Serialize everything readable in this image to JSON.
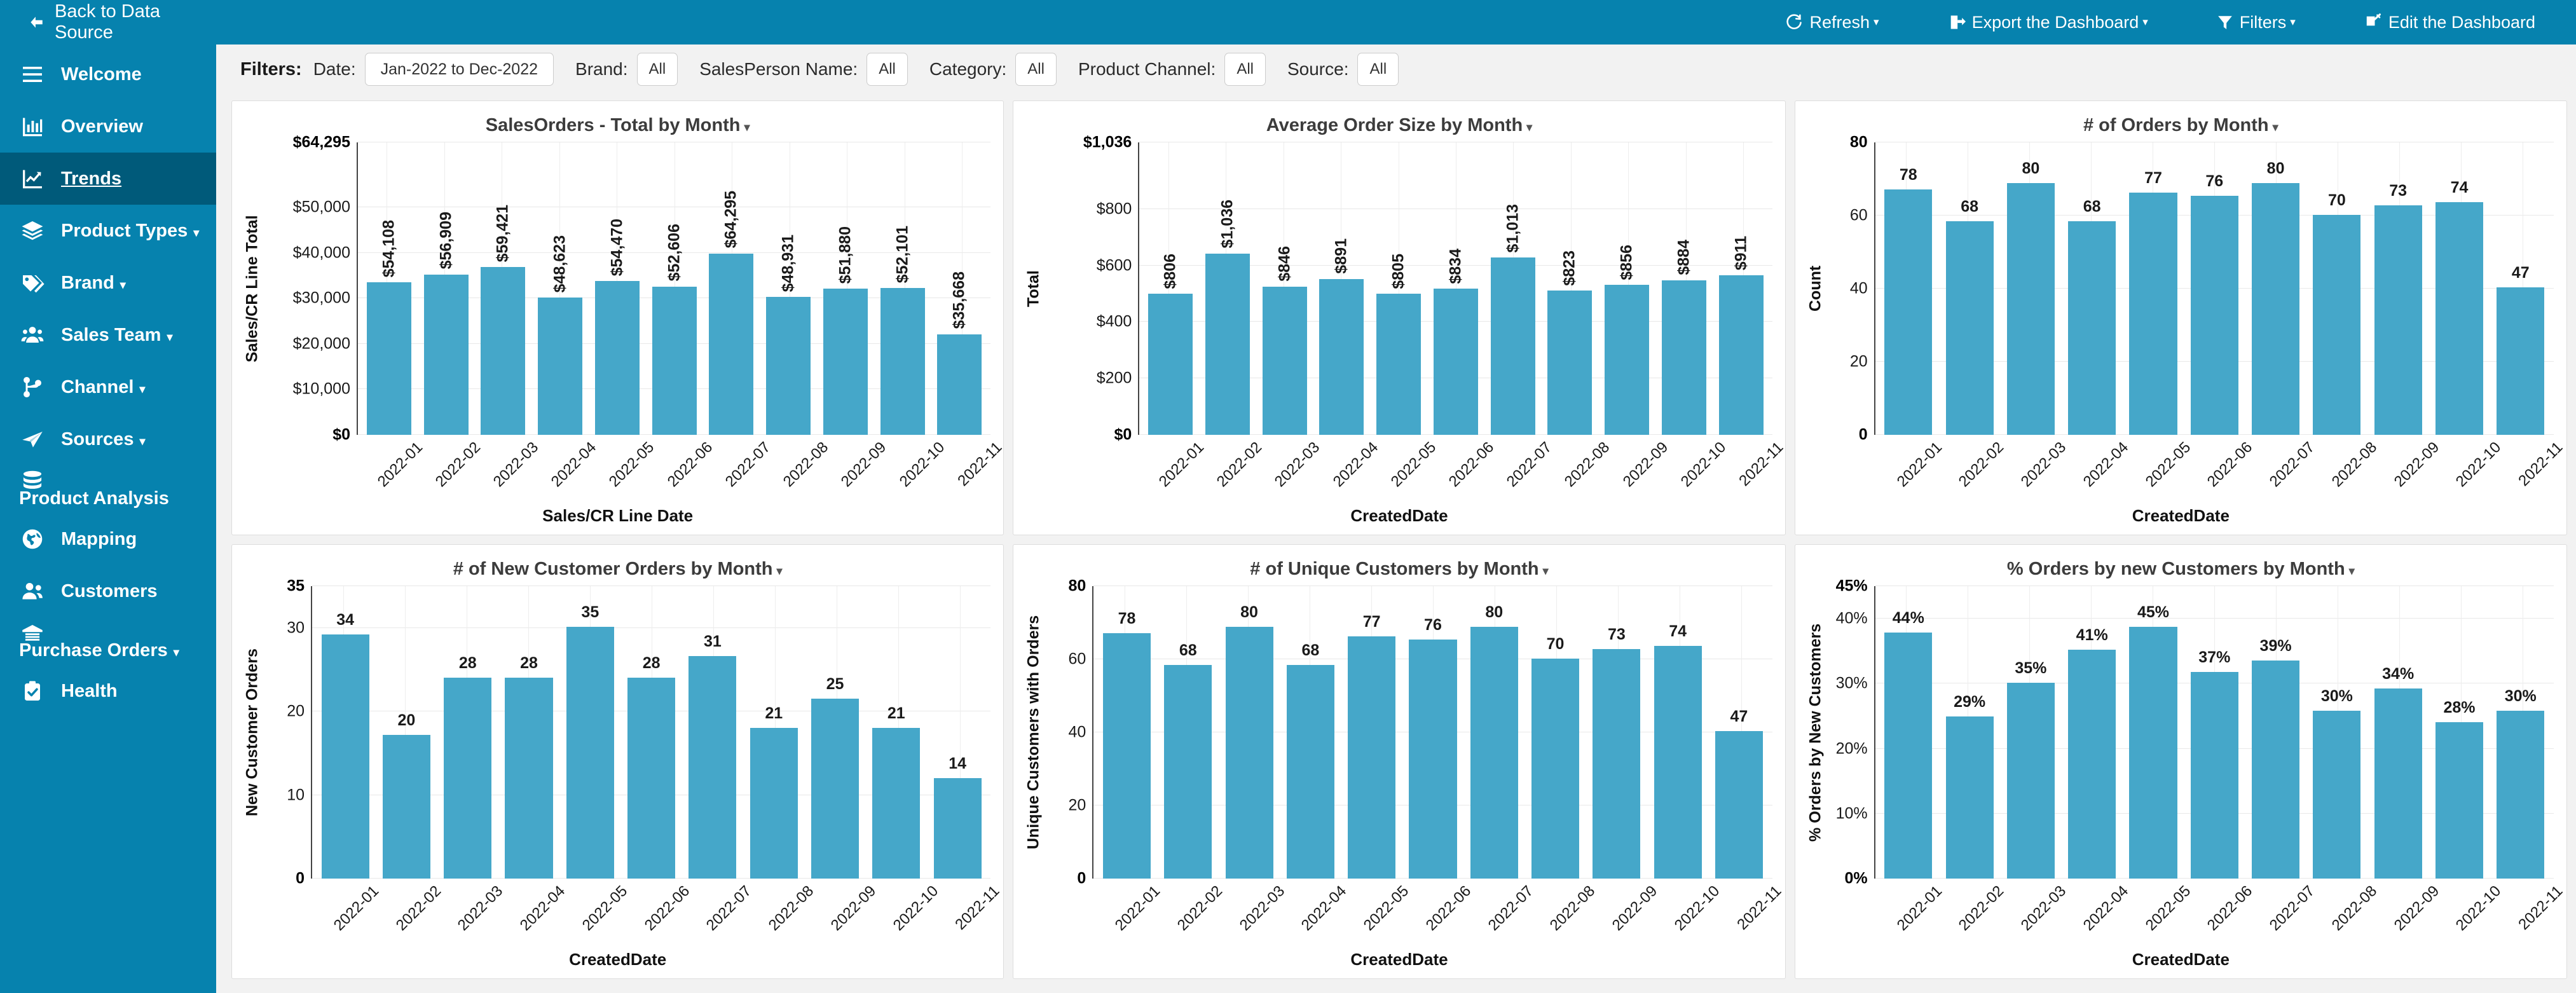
{
  "topbar": {
    "back_label": "Back to Data Source",
    "back_icon": "arrow-left-icon",
    "actions": [
      {
        "label": "Refresh",
        "icon": "refresh-icon",
        "caret": "▾"
      },
      {
        "label": "Export the Dashboard",
        "icon": "export-icon",
        "caret": "▾"
      },
      {
        "label": "Filters",
        "icon": "funnel-icon",
        "caret": "▾"
      },
      {
        "label": "Edit the Dashboard",
        "icon": "edit-icon",
        "caret": ""
      }
    ]
  },
  "sidebar": {
    "items": [
      {
        "label": "Welcome",
        "icon": "hamburger-icon",
        "caret": "",
        "active": false
      },
      {
        "label": "Overview",
        "icon": "bar-chart-icon",
        "caret": "",
        "active": false
      },
      {
        "label": "Trends",
        "icon": "line-chart-icon",
        "caret": "",
        "active": true
      },
      {
        "label": "Product Types",
        "icon": "layers-icon",
        "caret": "▾",
        "active": false
      },
      {
        "label": "Brand",
        "icon": "tag-icon",
        "caret": "▾",
        "active": false
      },
      {
        "label": "Sales Team",
        "icon": "users-group-icon",
        "caret": "▾",
        "active": false
      },
      {
        "label": "Channel",
        "icon": "sitemap-icon",
        "caret": "▾",
        "active": false
      },
      {
        "label": "Sources",
        "icon": "paper-plane-icon",
        "caret": "▾",
        "active": false
      },
      {
        "label": "Product Analysis",
        "icon": "database-icon",
        "caret": "",
        "active": false
      },
      {
        "label": "Mapping",
        "icon": "globe-icon",
        "caret": "",
        "active": false
      },
      {
        "label": "Customers",
        "icon": "users-icon",
        "caret": "",
        "active": false
      },
      {
        "label": "Purchase Orders",
        "icon": "warehouse-icon",
        "caret": "▾",
        "active": false
      },
      {
        "label": "Health",
        "icon": "clipboard-check-icon",
        "caret": "",
        "active": false
      }
    ]
  },
  "filters": {
    "title": "Filters:",
    "items": [
      {
        "name": "Date:",
        "value": "Jan-2022 to Dec-2022",
        "wide": true
      },
      {
        "name": "Brand:",
        "value": "All",
        "wide": false
      },
      {
        "name": "SalesPerson Name:",
        "value": "All",
        "wide": false
      },
      {
        "name": "Category:",
        "value": "All",
        "wide": false
      },
      {
        "name": "Product Channel:",
        "value": "All",
        "wide": false
      },
      {
        "name": "Source:",
        "value": "All",
        "wide": false
      }
    ]
  },
  "theme": {
    "brand_blue": "#0682ae",
    "active_blue": "#005a7a",
    "bar_blue": "#45a7c9",
    "page_bg": "#f2f2f2"
  },
  "chart_data": [
    {
      "id": "sales-orders-total-by-month",
      "type": "bar",
      "title": "SalesOrders - Total by Month",
      "caret": "▾",
      "xlabel": "Sales/CR Line Date",
      "ylabel": "Sales/CR Line Total",
      "categories": [
        "2022-01",
        "2022-02",
        "2022-03",
        "2022-04",
        "2022-05",
        "2022-06",
        "2022-07",
        "2022-08",
        "2022-09",
        "2022-10",
        "2022-11"
      ],
      "values": [
        54108,
        56909,
        59421,
        48623,
        54470,
        52606,
        64295,
        48931,
        51880,
        52101,
        35668
      ],
      "labels": [
        "$54,108",
        "$56,909",
        "$59,421",
        "$48,623",
        "$54,470",
        "$52,606",
        "$64,295",
        "$48,931",
        "$51,880",
        "$52,101",
        "$35,668"
      ],
      "label_orientation": "vertical",
      "ylim": [
        0,
        64295
      ],
      "yticks": [
        0,
        10000,
        20000,
        30000,
        40000,
        50000,
        64295
      ],
      "ytick_labels": [
        "$0",
        "$10,000",
        "$20,000",
        "$30,000",
        "$40,000",
        "$50,000",
        "$64,295"
      ],
      "ytick_bold": [
        true,
        false,
        false,
        false,
        false,
        false,
        true
      ],
      "grid": true
    },
    {
      "id": "average-order-size-by-month",
      "type": "bar",
      "title": "Average Order Size by Month",
      "caret": "▾",
      "xlabel": "CreatedDate",
      "ylabel": "Total",
      "categories": [
        "2022-01",
        "2022-02",
        "2022-03",
        "2022-04",
        "2022-05",
        "2022-06",
        "2022-07",
        "2022-08",
        "2022-09",
        "2022-10",
        "2022-11"
      ],
      "values": [
        806,
        1036,
        846,
        891,
        805,
        834,
        1013,
        823,
        856,
        884,
        911
      ],
      "labels": [
        "$806",
        "$1,036",
        "$846",
        "$891",
        "$805",
        "$834",
        "$1,013",
        "$823",
        "$856",
        "$884",
        "$911"
      ],
      "label_orientation": "vertical",
      "ylim": [
        0,
        1036
      ],
      "yticks": [
        0,
        200,
        400,
        600,
        800,
        1036
      ],
      "ytick_labels": [
        "$0",
        "$200",
        "$400",
        "$600",
        "$800",
        "$1,036"
      ],
      "ytick_bold": [
        true,
        false,
        false,
        false,
        false,
        true
      ],
      "grid": true
    },
    {
      "id": "number-of-orders-by-month",
      "type": "bar",
      "title": "# of Orders by Month",
      "caret": "▾",
      "xlabel": "CreatedDate",
      "ylabel": "Count",
      "categories": [
        "2022-01",
        "2022-02",
        "2022-03",
        "2022-04",
        "2022-05",
        "2022-06",
        "2022-07",
        "2022-08",
        "2022-09",
        "2022-10",
        "2022-11"
      ],
      "values": [
        78,
        68,
        80,
        68,
        77,
        76,
        80,
        70,
        73,
        74,
        47
      ],
      "labels": [
        "78",
        "68",
        "80",
        "68",
        "77",
        "76",
        "80",
        "70",
        "73",
        "74",
        "47"
      ],
      "label_orientation": "horizontal",
      "ylim": [
        0,
        80
      ],
      "yticks": [
        0,
        20,
        40,
        60,
        80
      ],
      "ytick_labels": [
        "0",
        "20",
        "40",
        "60",
        "80"
      ],
      "ytick_bold": [
        true,
        false,
        false,
        false,
        true
      ],
      "grid": true
    },
    {
      "id": "number-of-new-customer-orders-by-month",
      "type": "bar",
      "title": "# of New Customer Orders by Month",
      "caret": "▾",
      "xlabel": "CreatedDate",
      "ylabel": "New Customer Orders",
      "categories": [
        "2022-01",
        "2022-02",
        "2022-03",
        "2022-04",
        "2022-05",
        "2022-06",
        "2022-07",
        "2022-08",
        "2022-09",
        "2022-10",
        "2022-11"
      ],
      "values": [
        34,
        20,
        28,
        28,
        35,
        28,
        31,
        21,
        25,
        21,
        14
      ],
      "labels": [
        "34",
        "20",
        "28",
        "28",
        "35",
        "28",
        "31",
        "21",
        "25",
        "21",
        "14"
      ],
      "label_orientation": "horizontal",
      "ylim": [
        0,
        35
      ],
      "yticks": [
        0,
        10,
        20,
        30,
        35
      ],
      "ytick_labels": [
        "0",
        "10",
        "20",
        "30",
        "35"
      ],
      "ytick_bold": [
        true,
        false,
        false,
        false,
        true
      ],
      "grid": true
    },
    {
      "id": "number-of-unique-customers-by-month",
      "type": "bar",
      "title": "# of Unique Customers by Month",
      "caret": "▾",
      "xlabel": "CreatedDate",
      "ylabel": "Unique Customers with Orders",
      "categories": [
        "2022-01",
        "2022-02",
        "2022-03",
        "2022-04",
        "2022-05",
        "2022-06",
        "2022-07",
        "2022-08",
        "2022-09",
        "2022-10",
        "2022-11"
      ],
      "values": [
        78,
        68,
        80,
        68,
        77,
        76,
        80,
        70,
        73,
        74,
        47
      ],
      "labels": [
        "78",
        "68",
        "80",
        "68",
        "77",
        "76",
        "80",
        "70",
        "73",
        "74",
        "47"
      ],
      "label_orientation": "horizontal",
      "ylim": [
        0,
        80
      ],
      "yticks": [
        0,
        20,
        40,
        60,
        80
      ],
      "ytick_labels": [
        "0",
        "20",
        "40",
        "60",
        "80"
      ],
      "ytick_bold": [
        true,
        false,
        false,
        false,
        true
      ],
      "grid": true
    },
    {
      "id": "percent-orders-by-new-customers-by-month",
      "type": "bar",
      "title": "% Orders by new Customers by Month",
      "caret": "▾",
      "xlabel": "CreatedDate",
      "ylabel": "% Orders by New Customers",
      "categories": [
        "2022-01",
        "2022-02",
        "2022-03",
        "2022-04",
        "2022-05",
        "2022-06",
        "2022-07",
        "2022-08",
        "2022-09",
        "2022-10",
        "2022-11"
      ],
      "values": [
        44,
        29,
        35,
        41,
        45,
        37,
        39,
        30,
        34,
        28,
        30
      ],
      "labels": [
        "44%",
        "29%",
        "35%",
        "41%",
        "45%",
        "37%",
        "39%",
        "30%",
        "34%",
        "28%",
        "30%"
      ],
      "label_orientation": "horizontal",
      "ylim": [
        0,
        45
      ],
      "yticks": [
        0,
        10,
        20,
        30,
        40,
        45
      ],
      "ytick_labels": [
        "0%",
        "10%",
        "20%",
        "30%",
        "40%",
        "45%"
      ],
      "ytick_bold": [
        true,
        false,
        false,
        false,
        false,
        true
      ],
      "grid": true
    }
  ]
}
